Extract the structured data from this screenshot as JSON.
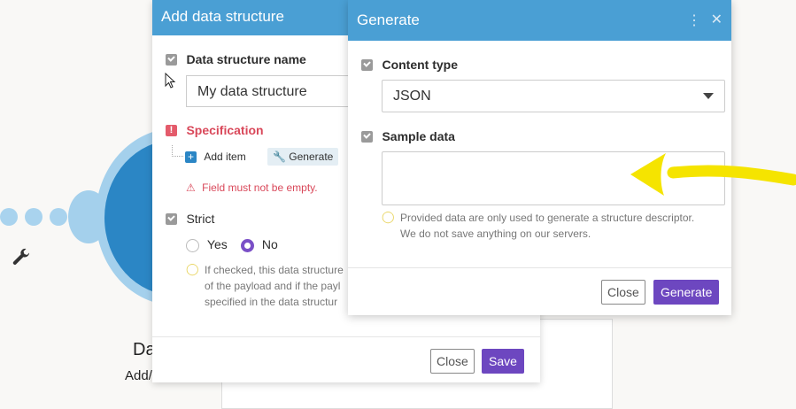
{
  "background": {
    "label_top": "Da",
    "label_bottom": "Add/"
  },
  "add_data_structure": {
    "title": "Add data structure",
    "name_label": "Data structure name",
    "name_value": "My data structure",
    "spec_label": "Specification",
    "add_item_label": "Add item",
    "generate_chip_label": "Generate",
    "error_text": "Field must not be empty.",
    "strict_label": "Strict",
    "yes_label": "Yes",
    "no_label": "No",
    "hint_line1": "If checked, this data structure",
    "hint_line2": "of the payload and if the payl",
    "hint_line3": "specified in the data structur",
    "close_label": "Close",
    "save_label": "Save"
  },
  "generate": {
    "title": "Generate",
    "content_type_label": "Content type",
    "content_type_value": "JSON",
    "sample_data_label": "Sample data",
    "hint_line1": "Provided data are only used to generate a structure descriptor.",
    "hint_line2": "We do not save anything on our servers.",
    "close_label": "Close",
    "generate_label": "Generate"
  },
  "colors": {
    "header_blue": "#4a9fd4",
    "primary_purple": "#6d47c0",
    "error_red": "#d9485a",
    "annotation_yellow": "#f5e400"
  },
  "icons": [
    "wrench-icon",
    "checkbox-icon",
    "error-icon",
    "plus-icon",
    "warning-icon",
    "bulb-icon",
    "kebab-menu-icon",
    "close-icon",
    "caret-down-icon"
  ]
}
